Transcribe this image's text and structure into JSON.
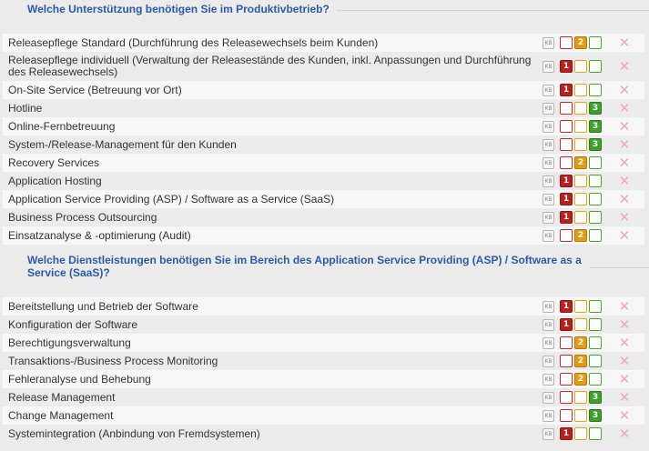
{
  "section1": {
    "title": "Welche Unterstützung benötigen Sie im Produktivbetrieb?",
    "rows": [
      {
        "label": "Releasepflege Standard (Durchführung des Releasewechsels beim Kunden)",
        "selected": 2
      },
      {
        "label": "Releasepflege individuell (Verwaltung der Releasestände des Kunden, inkl. Anpassungen und Durchführung des Releasewechsels)",
        "selected": 1
      },
      {
        "label": "On-Site Service (Betreuung vor Ort)",
        "selected": 1
      },
      {
        "label": "Hotline",
        "selected": 3
      },
      {
        "label": "Online-Fernbetreuung",
        "selected": 3
      },
      {
        "label": "System-/Release-Management für den Kunden",
        "selected": 3
      },
      {
        "label": "Recovery Services",
        "selected": 2
      },
      {
        "label": "Application Hosting",
        "selected": 1
      },
      {
        "label": "Application Service Providing (ASP) / Software as a Service (SaaS)",
        "selected": 1
      },
      {
        "label": "Business Process Outsourcing",
        "selected": 1
      },
      {
        "label": "Einsatzanalyse & -optimierung (Audit)",
        "selected": 2
      }
    ]
  },
  "section2": {
    "title": "Welche Dienstleistungen benötigen Sie im Bereich des Application Service Providing (ASP) / Software as a Service (SaaS)?",
    "rows": [
      {
        "label": "Bereitstellung und Betrieb der Software",
        "selected": 1
      },
      {
        "label": "Konfiguration der Software",
        "selected": 1
      },
      {
        "label": "Berechtigungsverwaltung",
        "selected": 2
      },
      {
        "label": "Transaktions-/Business Process Monitoring",
        "selected": 2
      },
      {
        "label": "Fehleranalyse und Behebung",
        "selected": 2
      },
      {
        "label": "Release Management",
        "selected": 3
      },
      {
        "label": "Change Management",
        "selected": 3
      },
      {
        "label": "Systemintegration (Anbindung von Fremdsystemen)",
        "selected": 1
      }
    ]
  },
  "controls": {
    "kb_text": "KB",
    "priorities": [
      "1",
      "2",
      "3"
    ],
    "delete_symbol": "✕"
  },
  "colors": {
    "priority_1": "#b8201f",
    "priority_2": "#e39c12",
    "priority_3": "#3e9f2a",
    "title": "#2c5aa8"
  }
}
